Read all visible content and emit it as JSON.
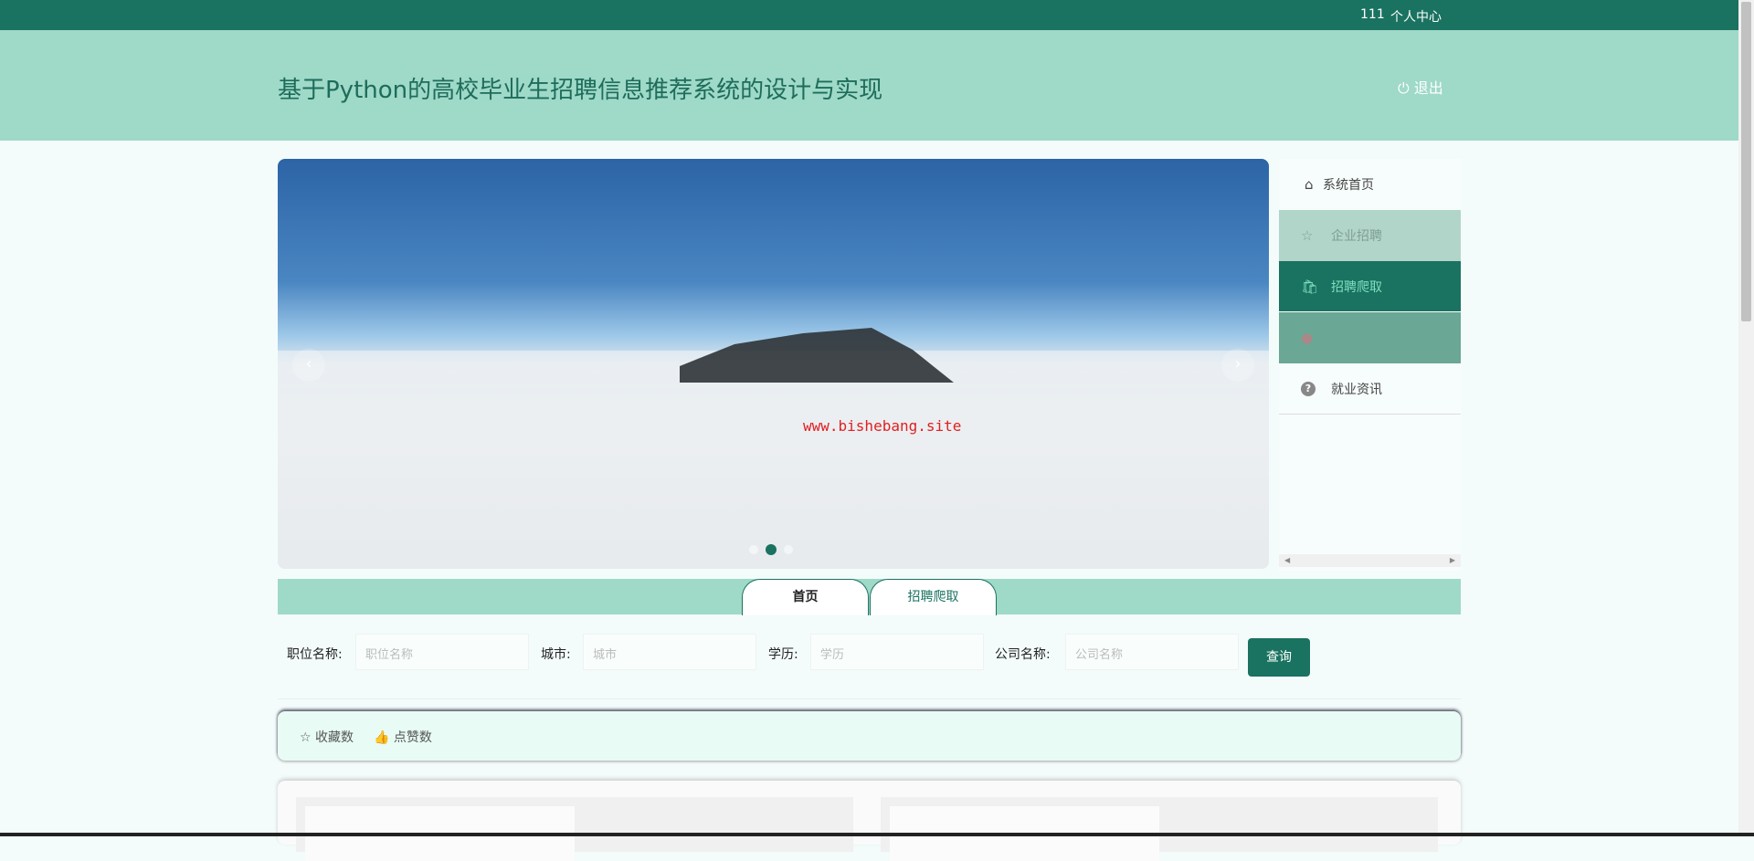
{
  "topbar": {
    "username": "111",
    "profile_link": "个人中心"
  },
  "header": {
    "title": "基于Python的高校毕业生招聘信息推荐系统的设计与实现",
    "logout": "退出"
  },
  "carousel": {
    "watermark": "www.bishebang.site",
    "prev": "‹",
    "next": "›",
    "slide_count": 3,
    "active_slide": 2
  },
  "sidebar": {
    "items": [
      {
        "label": "系统首页",
        "icon": "⌂"
      },
      {
        "label": "企业招聘",
        "icon": "☆"
      },
      {
        "label": "招聘爬取",
        "icon": "🛍"
      },
      {
        "label": "",
        "icon": "●"
      },
      {
        "label": "就业资讯",
        "icon": "?"
      }
    ]
  },
  "tabs": [
    {
      "label": "首页"
    },
    {
      "label": "招聘爬取"
    }
  ],
  "search": {
    "fields": [
      {
        "label": "职位名称:",
        "placeholder": "职位名称"
      },
      {
        "label": "城市:",
        "placeholder": "城市"
      },
      {
        "label": "学历:",
        "placeholder": "学历"
      },
      {
        "label": "公司名称:",
        "placeholder": "公司名称"
      }
    ],
    "button": "查询"
  },
  "sort": {
    "favorites": "☆ 收藏数",
    "likes": "👍 点赞数"
  },
  "colors": {
    "primary": "#1a7260",
    "header_bg": "#9fd9c8"
  }
}
